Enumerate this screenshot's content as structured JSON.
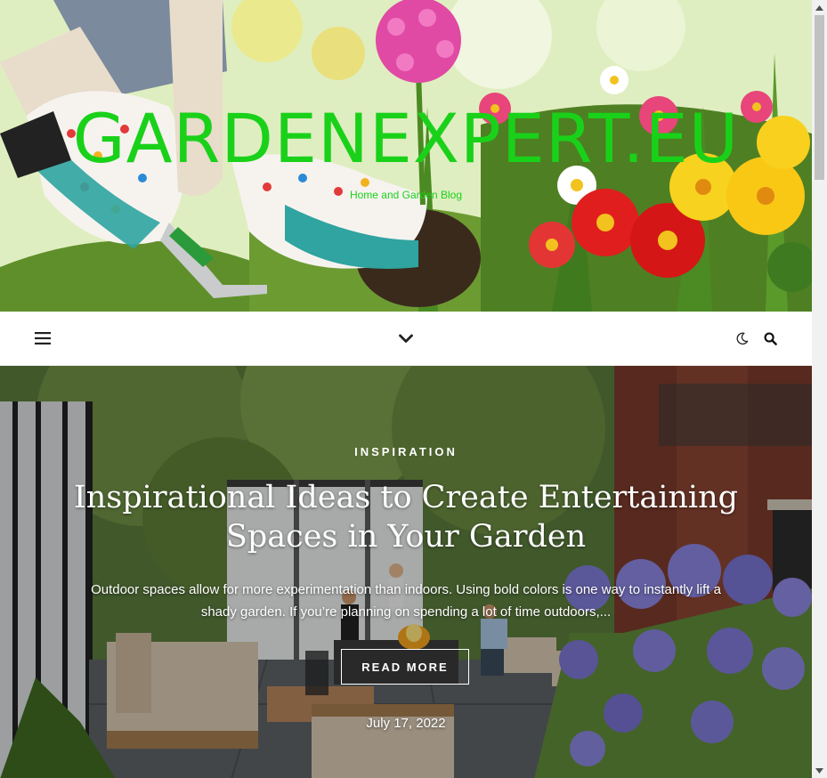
{
  "site": {
    "title": "GARDENEXPERT.EU",
    "tagline": "Home and Garden Blog"
  },
  "navbar": {
    "menu_icon": "hamburger-menu-icon",
    "dropdown_icon": "chevron-down-icon",
    "dark_mode_icon": "moon-icon",
    "search_icon": "search-icon"
  },
  "featured_post": {
    "category": "INSPIRATION",
    "title": "Inspirational Ideas to Create Entertaining Spaces in Your Garden",
    "excerpt": "Outdoor spaces allow for more experimentation than indoors. Using bold colors is one way to instantly lift a shady garden. If you’re planning on spending a lot of time outdoors,...",
    "read_more_label": "READ MORE",
    "date": "July 17, 2022"
  },
  "colors": {
    "title_green": "#1ad11a",
    "nav_background": "#ffffff",
    "icon_color": "#222222"
  }
}
